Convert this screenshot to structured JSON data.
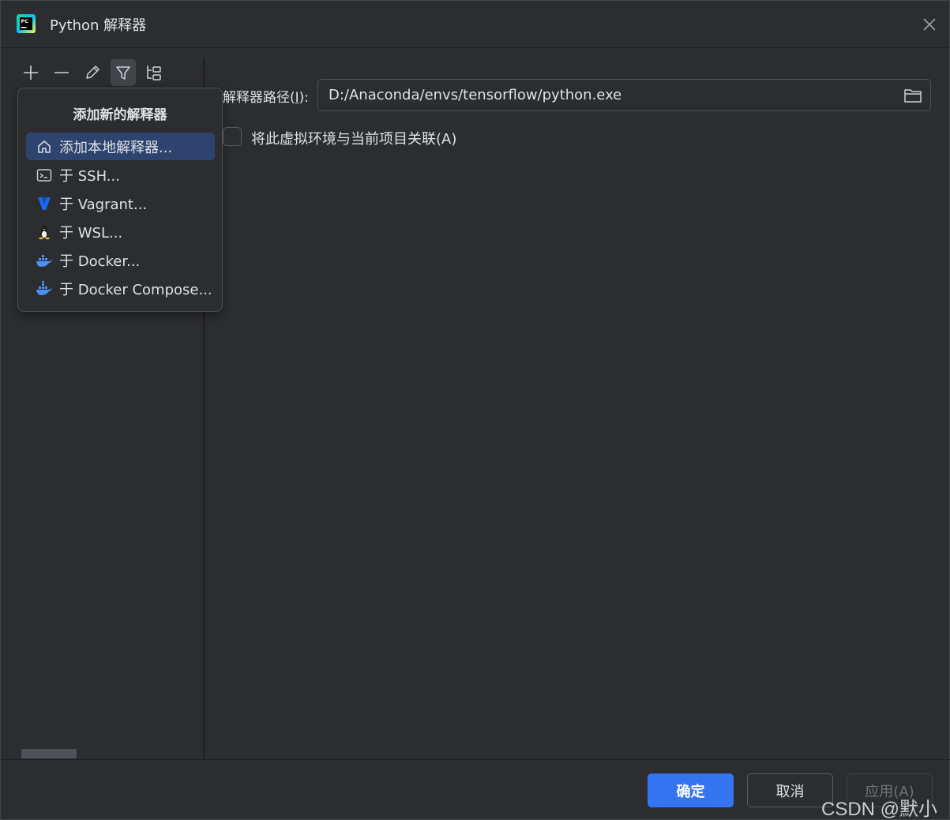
{
  "titlebar": {
    "title": "Python 解释器",
    "app_icon": "pycharm-icon",
    "close_icon": "close-icon"
  },
  "toolbar": {
    "buttons": [
      {
        "icon": "plus-icon"
      },
      {
        "icon": "minus-icon"
      },
      {
        "icon": "edit-icon"
      },
      {
        "icon": "filter-icon",
        "active": true
      },
      {
        "icon": "tree-icon"
      }
    ]
  },
  "popup": {
    "title": "添加新的解释器",
    "items": [
      {
        "label": "添加本地解释器...",
        "icon": "home-icon",
        "selected": true
      },
      {
        "label": "于 SSH...",
        "icon": "terminal-icon"
      },
      {
        "label": "于 Vagrant...",
        "icon": "vagrant-icon"
      },
      {
        "label": "于 WSL...",
        "icon": "linux-icon"
      },
      {
        "label": "于 Docker...",
        "icon": "docker-icon"
      },
      {
        "label": "于 Docker Compose...",
        "icon": "docker-compose-icon"
      }
    ]
  },
  "main": {
    "path_label_prefix": "解释器路径(",
    "path_label_mnemonic": "I",
    "path_label_suffix": "):",
    "path_value": "D:/Anaconda/envs/tensorflow/python.exe",
    "checkbox_label": "将此虚拟环境与当前项目关联(A)",
    "checkbox_checked": false
  },
  "footer": {
    "ok_label": "确定",
    "cancel_label": "取消",
    "apply_label": "应用(A)"
  },
  "watermark": "CSDN @默小枚",
  "colors": {
    "background": "#2b2d30",
    "accent": "#3574f0",
    "selected_item": "#2e436e",
    "text": "#dfe1e5"
  }
}
